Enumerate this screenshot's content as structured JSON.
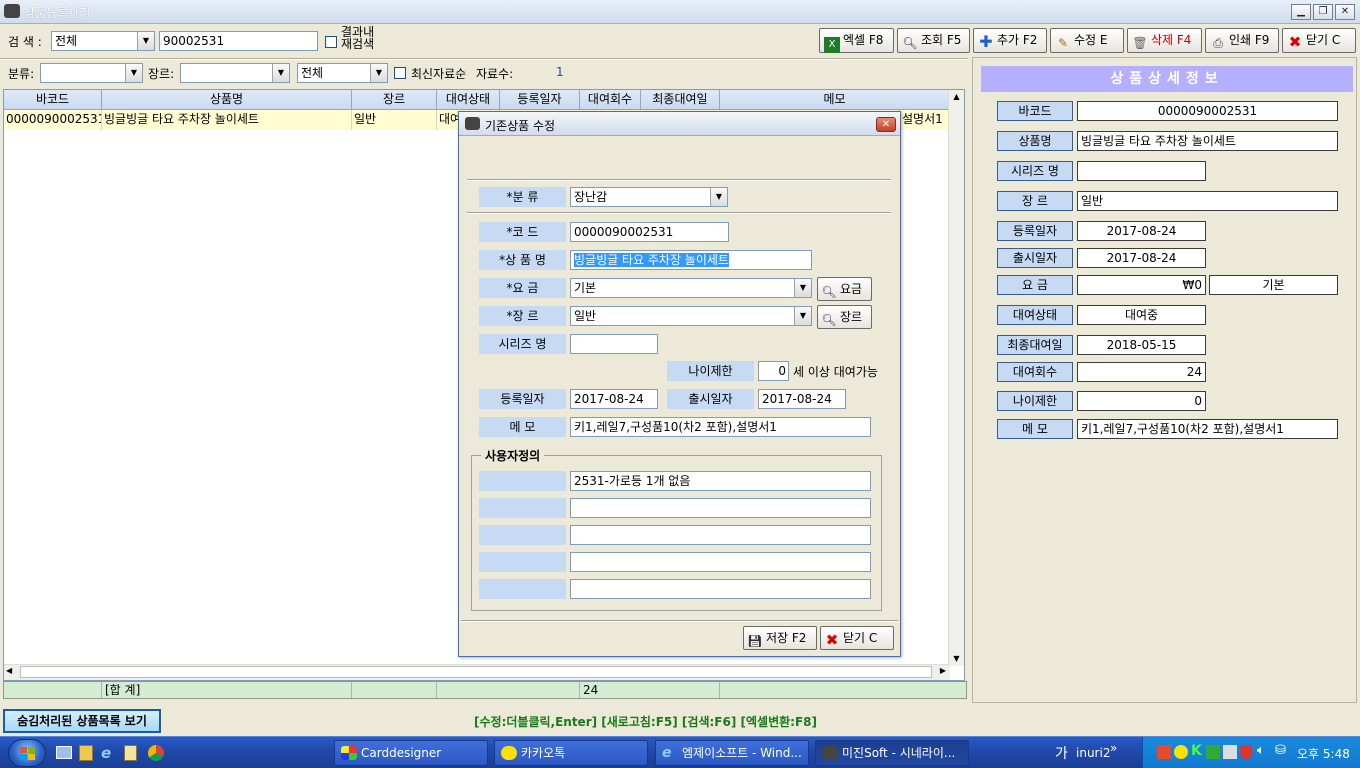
{
  "window": {
    "title": "상품등록관리"
  },
  "search": {
    "label": "검  색 :",
    "type_value": "전체",
    "query": "90002531",
    "in_result_label_1": "결과내",
    "in_result_label_2": "재검색"
  },
  "toolbar": {
    "excel": "엑셀 F8",
    "query": "조회 F5",
    "add": "추가 F2",
    "edit": "수정 E",
    "delete": "삭제 F4",
    "print": "인쇄 F9",
    "close": "닫기 C"
  },
  "filters": {
    "category_label": "분류:",
    "category_value": "",
    "genre_label": "장르:",
    "genre_value": "",
    "status_value": "전체",
    "newest_label": "최신자료순",
    "count_label": "자료수:",
    "count_value": "1"
  },
  "grid": {
    "columns": [
      "바코드",
      "상품명",
      "장르",
      "대여상태",
      "등록일자",
      "대여회수",
      "최종대여일",
      "메모"
    ],
    "row": {
      "barcode": "0000090002531",
      "name": "빙글빙글 타요 주차장 놀이세트",
      "genre": "일반",
      "status": "대여",
      "memo": "설명서1"
    }
  },
  "summary": {
    "label": "[합 계]",
    "rentals": "24"
  },
  "detail": {
    "title": "상품상세정보",
    "labels": {
      "barcode": "바코드",
      "name": "상품명",
      "series": "시리즈 명",
      "genre": "장 르",
      "reg_date": "등록일자",
      "release_date": "출시일자",
      "fee": "요 금",
      "status": "대여상태",
      "last_rental": "최종대여일",
      "rentals": "대여회수",
      "age": "나이제한",
      "memo": "메 모"
    },
    "values": {
      "barcode": "0000090002531",
      "name": "빙글빙글 타요 주차장 놀이세트",
      "series": "",
      "genre": "일반",
      "reg_date": "2017-08-24",
      "release_date": "2017-08-24",
      "fee": "₩0",
      "fee_type": "기본",
      "status": "대여중",
      "last_rental": "2018-05-15",
      "rentals": "24",
      "age": "0",
      "memo": "키1,레일7,구성품10(차2 포함),설명서1"
    }
  },
  "dialog": {
    "title": "기존상품 수정",
    "labels": {
      "category": "*분   류",
      "code": "*코    드",
      "name": "*상 품 명",
      "fee": "*요    금",
      "genre": "*장    르",
      "series": "시리즈 명",
      "age": "나이제한",
      "reg_date": "등록일자",
      "release_date": "출시일자",
      "memo": "메    모",
      "user_defined": "사용자정의"
    },
    "values": {
      "category": "장난감",
      "code": "0000090002531",
      "name": "빙글빙글 타요 주차장 놀이세트",
      "fee": "기본",
      "genre": "일반",
      "series": "",
      "age": "0",
      "age_suffix": "세 이상 대여가능",
      "reg_date": "2017-08-24",
      "release_date": "2017-08-24",
      "memo": "키1,레일7,구성품10(차2 포함),설명서1"
    },
    "fee_button": "요금",
    "genre_button": "장르",
    "user_fields": [
      "2531-가로등 1개 없음",
      "",
      "",
      "",
      ""
    ],
    "save": "저장 F2",
    "close": "닫기 C"
  },
  "footer": {
    "hidden_button": "숨김처리된 상품목록 보기",
    "hint": "[수정:더블클릭,Enter] [새로고침:F5] [검색:F6] [엑셀변환:F8]"
  },
  "taskbar": {
    "items": [
      "Carddesigner",
      "카카오톡",
      "엠제이소프트 - Wind...",
      "미진Soft - 시네라이..."
    ],
    "ime": "가",
    "user": "inuri2",
    "clock": "오후 5:48"
  },
  "colors": {
    "accent": "#b4b0ff",
    "label_bg": "#c6dbf3",
    "selected_row": "#fffcd2",
    "hint_text": "#1a7a1a"
  }
}
